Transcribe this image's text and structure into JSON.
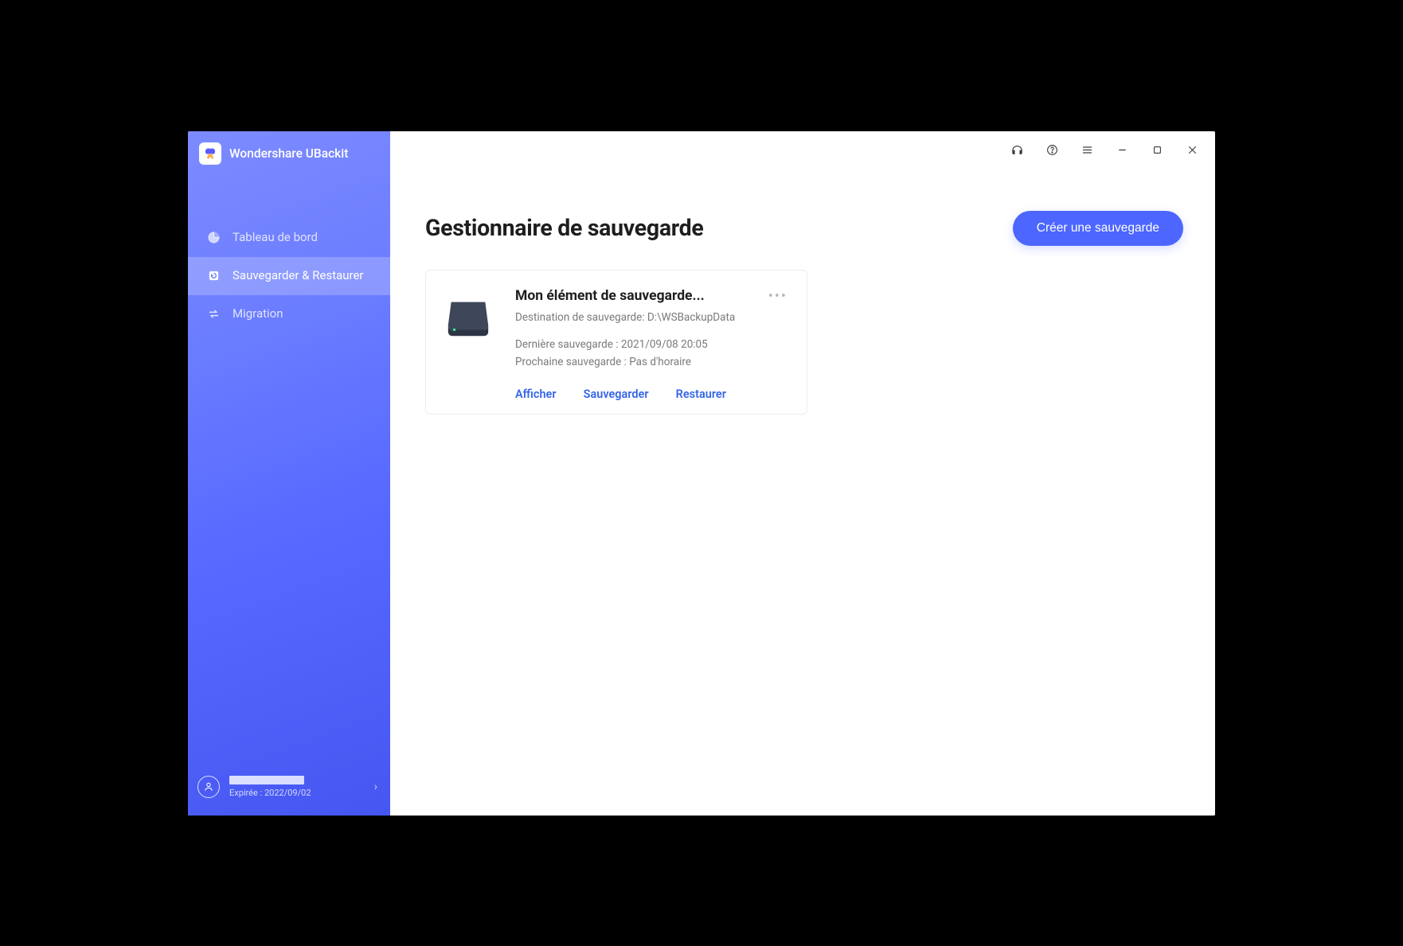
{
  "app_name": "Wondershare UBackit",
  "nav": {
    "dashboard": "Tableau de bord",
    "backup_restore": "Sauvegarder & Restaurer",
    "migration": "Migration"
  },
  "footer": {
    "expiry": "Expirée : 2022/09/02"
  },
  "main": {
    "title": "Gestionnaire de sauvegarde",
    "create_btn": "Créer une sauvegarde"
  },
  "card": {
    "title": "Mon élément de sauvegarde...",
    "dest_line": "Destination de sauvegarde: D:\\WSBackupData",
    "last_line": "Dernière sauvegarde : 2021/09/08 20:05",
    "next_line": "Prochaine sauvegarde : Pas d'horaire",
    "actions": {
      "view": "Afficher",
      "backup": "Sauvegarder",
      "restore": "Restaurer"
    }
  }
}
